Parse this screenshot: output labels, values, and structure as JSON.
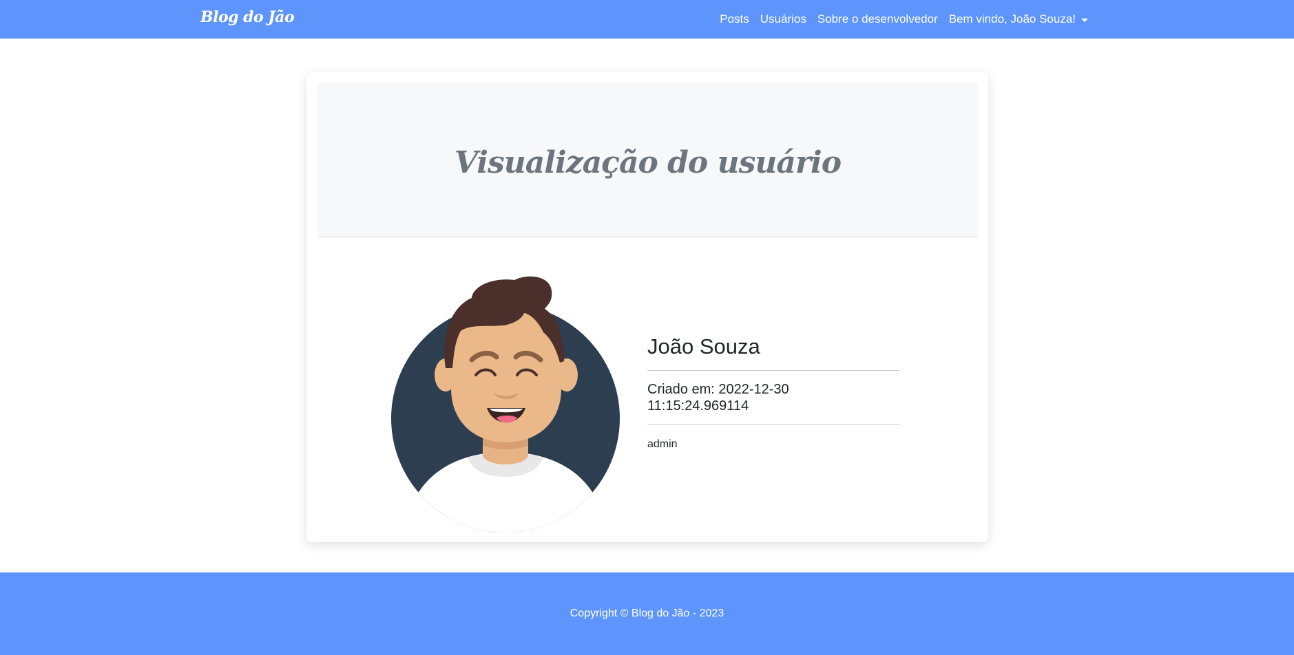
{
  "navbar": {
    "brand": "Blog do Jão",
    "links": [
      "Posts",
      "Usuários",
      "Sobre o desenvolvedor"
    ],
    "user_menu": "Bem vindo, João Souza!",
    "background_color": "#5e95fc"
  },
  "card": {
    "title": "Visualização do usuário",
    "avatar_icon": "user-avatar-illustration",
    "user": {
      "name": "João Souza",
      "created_line1": "Criado em: 2022-12-30",
      "created_line2": "11:15:24.969114",
      "role": "admin"
    }
  },
  "footer": {
    "text": "Copyright © Blog do Jão - 2023"
  }
}
